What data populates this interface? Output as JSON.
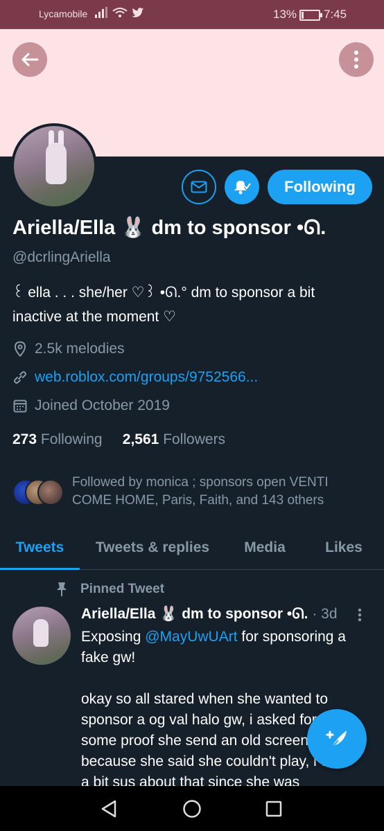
{
  "status_bar": {
    "carrier": "Lycamobile",
    "battery_percent": "13%",
    "battery_level": 0.13,
    "time": "7:45"
  },
  "colors": {
    "accent": "#1da1f2",
    "background": "#15202b",
    "muted": "#8899a6",
    "banner": "#fde2e6",
    "status_bar": "#7a3a4a"
  },
  "profile": {
    "display_name": "Ariella/Ella 🐰 dm to sponsor •ᘏ.",
    "handle": "@dcrlingAriella",
    "bio_line1": "꒰ ella . . . she/her  ♡꒱ •ᘏ.° dm to sponsor a bit",
    "bio_line2": "inactive at the moment ♡",
    "location": "2.5k melodies",
    "website": "web.roblox.com/groups/9752566...",
    "joined": "Joined October 2019",
    "following_count": "273",
    "following_label": "Following",
    "followers_count": "2,561",
    "followers_label": "Followers",
    "followed_by_line1": "Followed by monica ; sponsors open VENTI",
    "followed_by_line2": "COME HOME, Paris, Faith, and 143 others"
  },
  "actions": {
    "follow_label": "Following",
    "mail_icon": "envelope-icon",
    "bell_icon": "notification-bell-icon"
  },
  "tabs": [
    {
      "label": "Tweets",
      "active": true
    },
    {
      "label": "Tweets & replies",
      "active": false
    },
    {
      "label": "Media",
      "active": false
    },
    {
      "label": "Likes",
      "active": false
    }
  ],
  "pinned_tweet": {
    "pinned_label": "Pinned Tweet",
    "author": "Ariella/Ella 🐰 dm to sponsor •ᘏ.",
    "time": "· 3d",
    "line1_prefix": "Exposing ",
    "mention": "@MayUwUArt",
    "line1_suffix": " for sponsoring a",
    "line2": "fake gw!",
    "para2_line1": "okay so all stared when she wanted to",
    "para2_line2": "sponsor a og val halo gw, i asked for",
    "para2_line3": "some proof she send an old screenshot",
    "para2_line4": "because she said she couldn't play, i was",
    "para2_line5": "a bit sus about that since she was"
  }
}
